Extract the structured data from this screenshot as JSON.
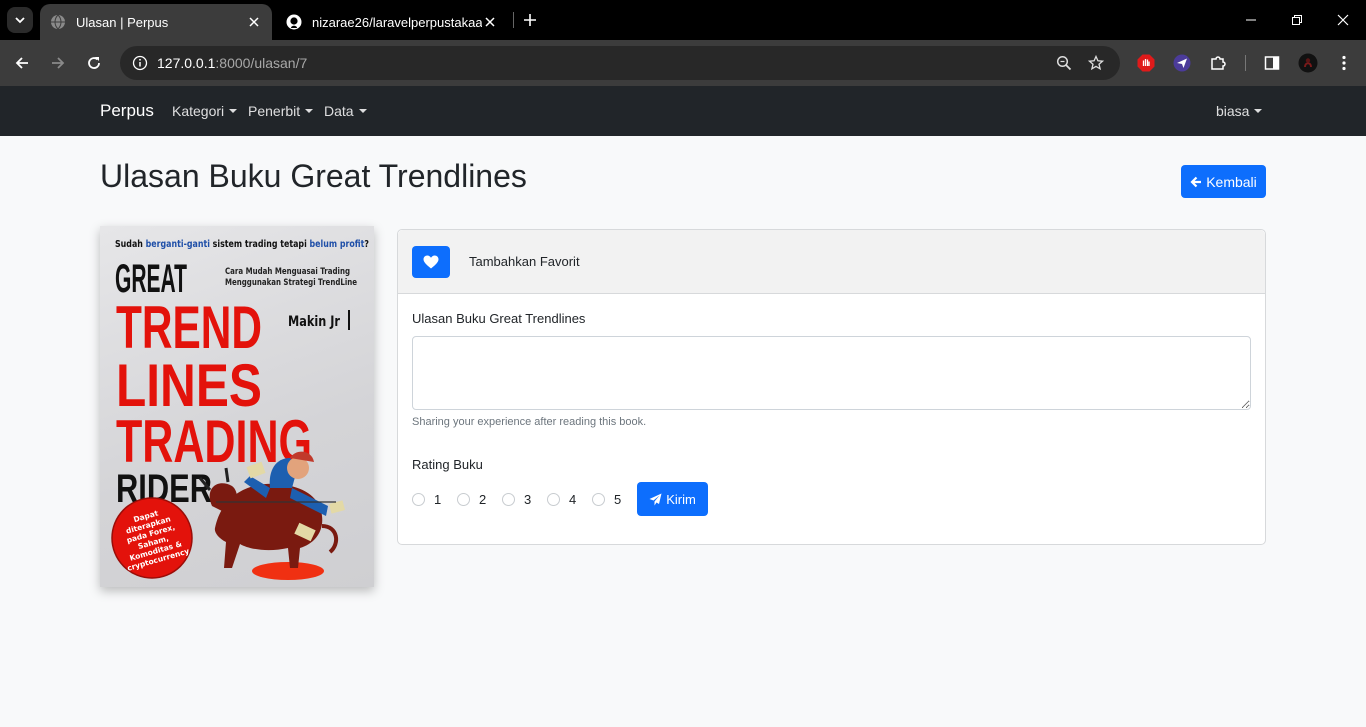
{
  "browser": {
    "tabs": [
      {
        "title": "Ulasan | Perpus",
        "active": true
      },
      {
        "title": "nizarae26/laravelperpustakaan",
        "active": false
      }
    ],
    "url_host": "127.0.0.1",
    "url_rest": ":8000/ulasan/7"
  },
  "navbar": {
    "brand": "Perpus",
    "menus": [
      "Kategori",
      "Penerbit",
      "Data"
    ],
    "user": "biasa"
  },
  "page": {
    "title": "Ulasan Buku Great Trendlines",
    "back_button": "Kembali"
  },
  "book_cover": {
    "tagline_prefix": "Sudah ",
    "tagline_highlight1": "berganti-ganti",
    "tagline_middle": " sistem trading tetapi ",
    "tagline_highlight2": "belum profit",
    "tagline_suffix": "?",
    "line1": "GREAT",
    "line2": "TREND",
    "line3": "LINES",
    "line4": "TRADING",
    "line5": "RIDER",
    "subtitle1": "Cara Mudah Menguasai Trading",
    "subtitle2": "Menggunakan Strategi TrendLine",
    "author": "Makin Jr",
    "badge": [
      "Dapat",
      "diterapkan",
      "pada Forex,",
      "Saham,",
      "Komoditas &",
      "cryptocurrency"
    ]
  },
  "review_form": {
    "favorite_label": "Tambahkan Favorit",
    "review_label": "Ulasan Buku Great Trendlines",
    "review_value": "",
    "help_text": "Sharing your experience after reading this book.",
    "rating_label": "Rating Buku",
    "rating_options": [
      "1",
      "2",
      "3",
      "4",
      "5"
    ],
    "submit_label": "Kirim"
  }
}
